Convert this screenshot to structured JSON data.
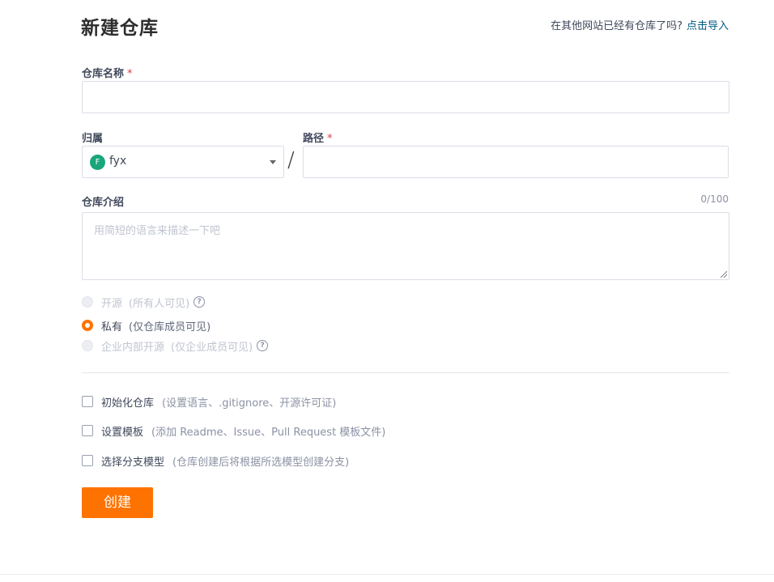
{
  "header": {
    "title": "新建仓库",
    "import_question": "在其他网站已经有仓库了吗?",
    "import_link": "点击导入"
  },
  "form": {
    "name": {
      "label": "仓库名称",
      "required_mark": "*",
      "value": ""
    },
    "owner": {
      "label": "归属",
      "avatar_letter": "F",
      "avatar_color": "#18a67a",
      "selected": "fyx"
    },
    "separator": "/",
    "path": {
      "label": "路径",
      "required_mark": "*",
      "value": ""
    },
    "description": {
      "label": "仓库介绍",
      "counter": "0/100",
      "placeholder": "用简短的语言来描述一下吧"
    },
    "visibility": [
      {
        "label": "开源",
        "hint": "(所有人可见)",
        "disabled": true,
        "checked": false,
        "help_icon": "question-circle-icon"
      },
      {
        "label": "私有",
        "hint": "(仅仓库成员可见)",
        "disabled": false,
        "checked": true
      },
      {
        "label": "企业内部开源",
        "hint": "(仅企业成员可见)",
        "disabled": true,
        "checked": false,
        "help_icon": "question-circle-icon"
      }
    ],
    "options": [
      {
        "label": "初始化仓库",
        "hint": "(设置语言、.gitignore、开源许可证)",
        "checked": false
      },
      {
        "label": "设置模板",
        "hint": "(添加 Readme、Issue、Pull Request 模板文件)",
        "checked": false
      },
      {
        "label": "选择分支模型",
        "hint": "(仓库创建后将根据所选模型创建分支)",
        "checked": false
      }
    ],
    "submit_label": "创建"
  },
  "colors": {
    "accent": "#fe7300",
    "link": "#005980",
    "required": "#e4393c"
  }
}
